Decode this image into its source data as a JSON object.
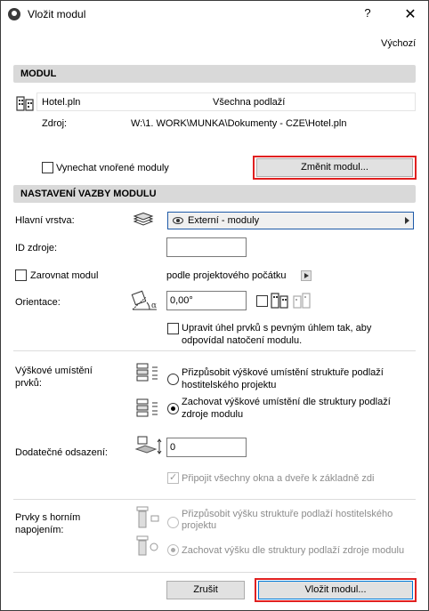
{
  "window": {
    "title": "Vložit modul",
    "help": "?",
    "close": "✕"
  },
  "header": {
    "defaults_link": "Výchozí"
  },
  "module_section": {
    "title": "MODUL",
    "file_name": "Hotel.pln",
    "stories": "Všechna podlaží",
    "source_label": "Zdroj:",
    "source_path": "W:\\1. WORK\\MUNKA\\Dokumenty - CZE\\Hotel.pln",
    "skip_nested_label": "Vynechat vnořené moduly",
    "change_button": "Změnit modul..."
  },
  "link_section": {
    "title": "NASTAVENÍ VAZBY MODULU",
    "main_layer_label": "Hlavní vrstva:",
    "main_layer_value": "Externí - moduly",
    "source_id_label": "ID zdroje:",
    "source_id_value": "",
    "align_label": "Zarovnat modul",
    "align_value": "podle projektového počátku",
    "orientation_label": "Orientace:",
    "orientation_value": "0,00°",
    "rotate_label": "Upravit úhel prvků s pevným úhlem tak, aby odpovídal natočení modulu.",
    "height_label": "Výškové umístění prvků:",
    "height_opt1": "Přizpůsobit výškové umístění struktuře podlaží hostitelského projektu",
    "height_opt2": "Zachovat výškové umístění dle struktury podlaží zdroje modulu",
    "offset_label": "Dodatečné odsazení:",
    "offset_value": "0",
    "attach_doors_label": "Připojit všechny okna a dveře k základně zdi",
    "top_linked_label": "Prvky s horním napojením:",
    "top_opt1": "Přizpůsobit výšku struktuře podlaží hostitelského projektu",
    "top_opt2": "Zachovat výšku dle struktury podlaží zdroje modulu"
  },
  "footer": {
    "cancel": "Zrušit",
    "place": "Vložit modul..."
  },
  "colors": {
    "highlight": "#e02020",
    "section_bg": "#d9d9d9",
    "dropdown_border": "#1e5aa8"
  }
}
